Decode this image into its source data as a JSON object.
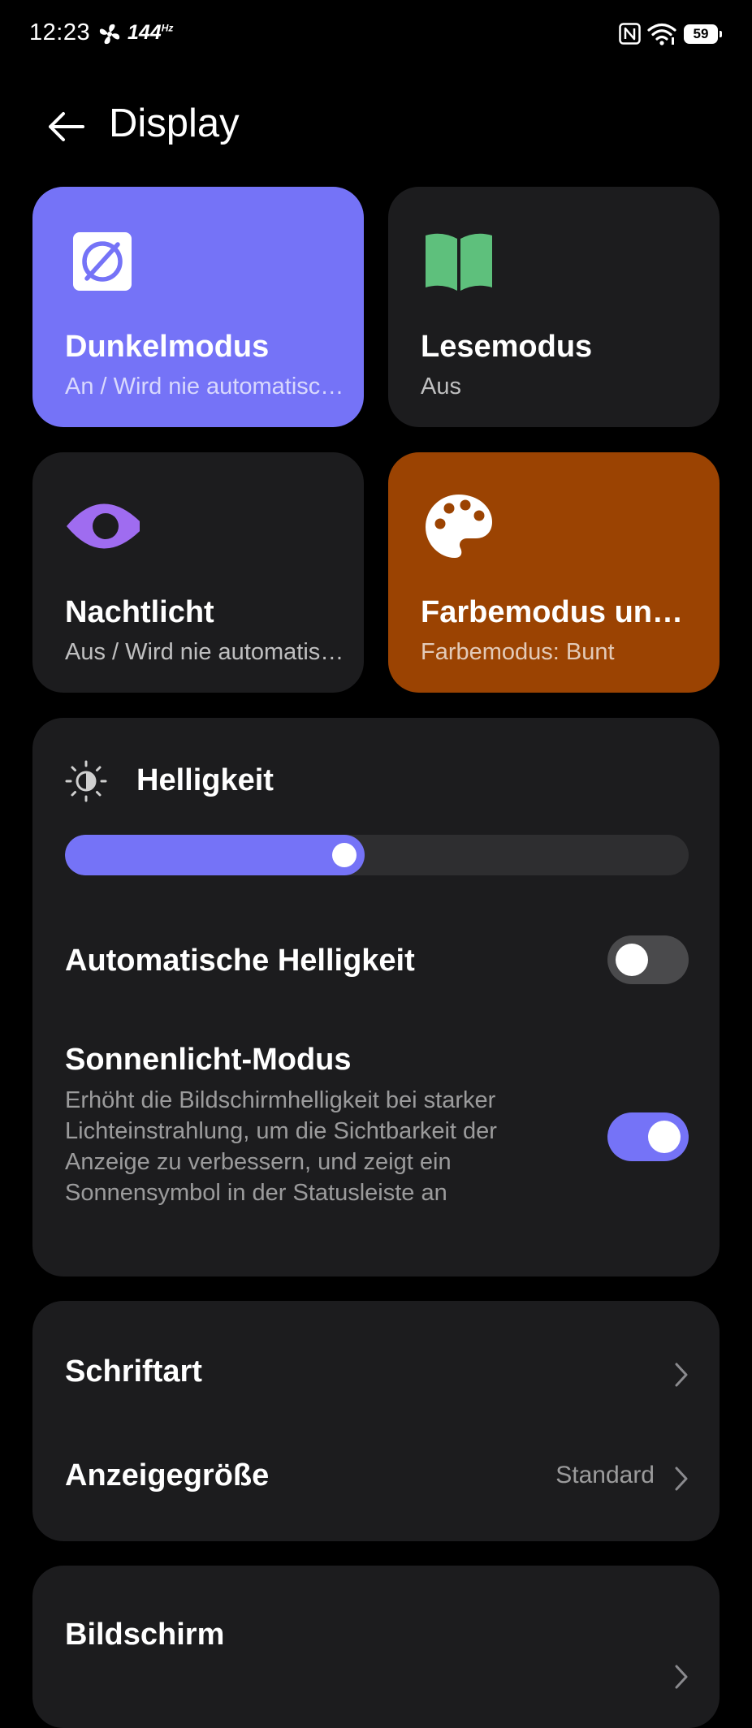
{
  "status_bar": {
    "time": "12:23",
    "fan_icon": "fan-icon",
    "refresh_rate": "144",
    "refresh_unit": "Hz",
    "nfc_icon": "nfc-icon",
    "wifi_icon": "wifi-icon",
    "battery": "59"
  },
  "header": {
    "back_icon": "arrow-left-icon",
    "title": "Display"
  },
  "tiles": [
    {
      "icon": "dark-mode-icon",
      "title": "Dunkelmodus",
      "subtitle": "An / Wird nie automatisch aktiviert",
      "color": "#7573f7"
    },
    {
      "icon": "book-icon",
      "title": "Lesemodus",
      "subtitle": "Aus",
      "color": "#1c1c1e"
    },
    {
      "icon": "eye-icon",
      "title": "Nachtlicht",
      "subtitle": "Aus / Wird nie automatisch aktiviert",
      "color": "#1c1c1e"
    },
    {
      "icon": "palette-icon",
      "title": "Farbemodus und Temperatur",
      "subtitle": "Farbemodus: Bunt",
      "color": "#9b4302"
    }
  ],
  "brightness": {
    "icon": "brightness-icon",
    "title": "Helligkeit",
    "level": 0.48,
    "auto_label": "Automatische Helligkeit",
    "auto_enabled": false,
    "sunlight_label": "Sonnenlicht-Modus",
    "sunlight_description": "Erhöht die Bildschirmhelligkeit bei starker Lichteinstrahlung, um die Sichtbarkeit der Anzeige zu verbessern, und zeigt ein Sonnensymbol in der Statusleiste an",
    "sunlight_enabled": true
  },
  "font_section": {
    "font_label": "Schriftart",
    "size_label": "Anzeigegröße",
    "size_value": "Standard"
  },
  "screen_section": {
    "title": "Bildschirm"
  },
  "colors": {
    "accent": "#7573f7",
    "card_bg": "#1c1c1e",
    "palette_tile": "#9b4302",
    "book_icon": "#5ec07c",
    "eye_icon": "#9f6cf0"
  }
}
